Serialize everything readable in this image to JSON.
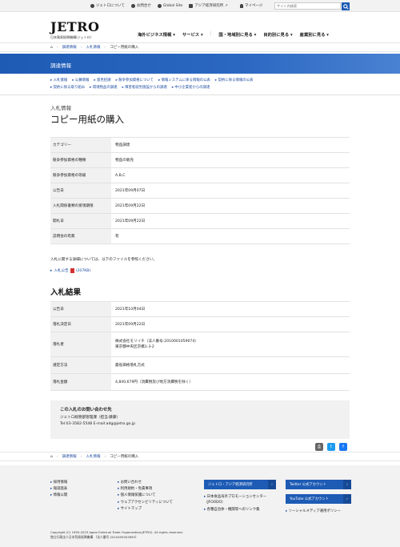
{
  "utility": {
    "links": [
      "ジェトロについて",
      "お問合せ",
      "Global Site",
      "アジア経済研究所"
    ],
    "mypage": "マイページ",
    "search_placeholder": "サイト内検索"
  },
  "logo": {
    "main": "JETRO",
    "sub": "日本貿易振興機構(ジェトロ)"
  },
  "gnav": [
    "海外ビジネス情報",
    "サービス",
    "国・地域別に見る",
    "目的別に見る",
    "産業別に見る"
  ],
  "breadcrumb": [
    "調達情報",
    "入札情報",
    "コピー用紙の購入"
  ],
  "banner_title": "調達情報",
  "subnav": {
    "row1": [
      "入札情報",
      "公募情報",
      "意見招請",
      "競争参加資格について",
      "情報システムに係る情報の公表",
      "契約に係る情報の公表"
    ],
    "row2": [
      "契約に係る取り組み",
      "環境物品の調達",
      "障害者就労施設からの調達",
      "中小企業者からの調達"
    ]
  },
  "category_label": "入札情報",
  "page_title": "コピー用紙の購入",
  "info_table": [
    {
      "k": "カテゴリー",
      "v": "物品調達"
    },
    {
      "k": "競争参加資格の種類",
      "v": "物品の販売"
    },
    {
      "k": "競争参加資格の等級",
      "v": "A,B,C"
    },
    {
      "k": "公告日",
      "v": "2021年09月07日"
    },
    {
      "k": "入札関係書類の受領期限",
      "v": "2021年09月22日"
    },
    {
      "k": "開札日",
      "v": "2021年09月22日"
    },
    {
      "k": "説明会の有無",
      "v": "有"
    }
  ],
  "note": "入札に関する詳細については、以下のファイルを参照ください。",
  "pdf_link": "入札公告",
  "pdf_size": "(207KB)",
  "result_title": "入札結果",
  "result_table": [
    {
      "k": "公告日",
      "v": "2021年10月04日"
    },
    {
      "k": "落札決定日",
      "v": "2021年09月22日"
    },
    {
      "k": "落札者",
      "v": "株式会社モリイチ（法人番号:2010001059074）",
      "v2": "東京都中央区京橋1-3-2"
    },
    {
      "k": "選定方法",
      "v": "最低価格落札方式"
    },
    {
      "k": "落札金額",
      "v": "4,840,679円（消費税及び地方消費税を除く）"
    }
  ],
  "contact": {
    "title": "この入札のお問い合わせ先",
    "line1": "ジェトロ総務部管理課（担当:藤藤）",
    "line2": "Tel:03-3582-5548 E-mail:adg@jetro.go.jp"
  },
  "footer": {
    "col1": [
      "採用情報",
      "報道発表",
      "情報公開"
    ],
    "col2": [
      "お問い合わせ",
      "利用規約・免責事項",
      "個人情報保護について",
      "ウェブアクセシビリティについて",
      "サイトマップ"
    ],
    "btn1": "ジェトロ・アジア経済研究所",
    "btn2": "Twitter 公式アカウント",
    "btn3": "YouTube 公式アカウント",
    "col3": [
      "日本食品海外プロモーションセンター（JFOODO）",
      "各種自治体・機関等へのリンク集"
    ],
    "col4": [
      "ソーシャルメディア運用ポリシー"
    ],
    "copyright": "Copyright (C) 1995-2023 Japan External Trade Organization(JETRO). All rights reserved.",
    "corp": "独立行政法人日本貿易振興機構 （法人番号 2010405003693）"
  },
  "colors": {
    "primary": "#1d5bb5",
    "twitter": "#1d9bf0",
    "facebook": "#1877f2"
  }
}
